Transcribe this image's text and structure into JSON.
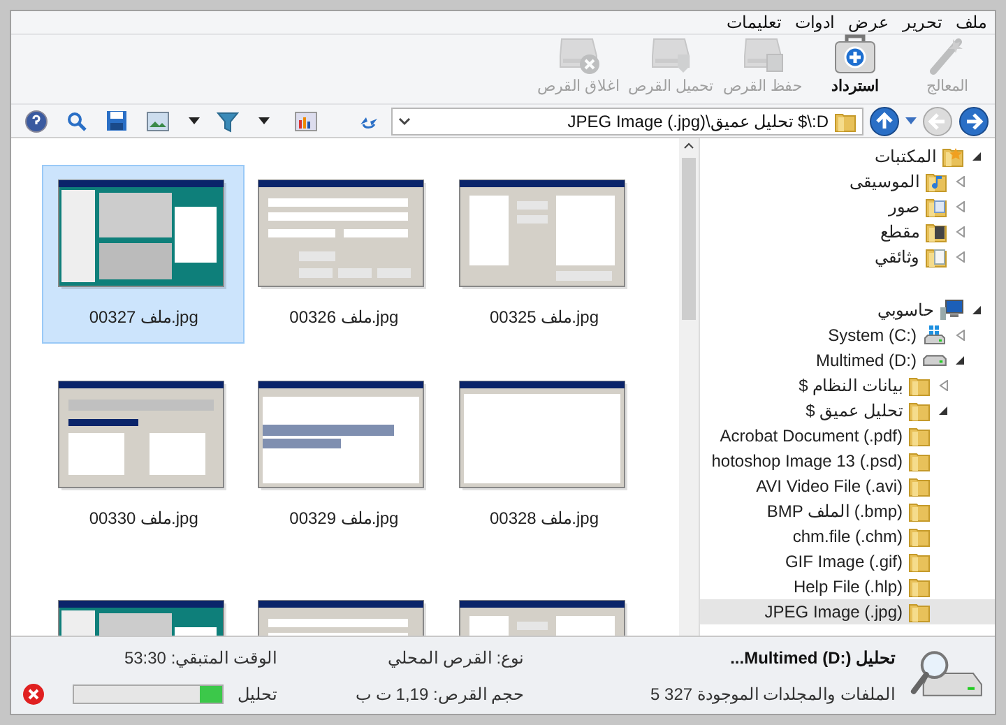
{
  "menu": [
    "ملف",
    "تحرير",
    "عرض",
    "ادوات",
    "تعليمات"
  ],
  "toolbar": [
    {
      "label": "المعالج",
      "kind": "wand",
      "disabled": true
    },
    {
      "label": "استرداد",
      "kind": "recover",
      "disabled": false
    },
    {
      "label": "حفظ القرص",
      "kind": "save",
      "disabled": true
    },
    {
      "label": "تحميل القرص",
      "kind": "load",
      "disabled": true
    },
    {
      "label": "اغلاق القرص",
      "kind": "close",
      "disabled": true
    }
  ],
  "address": {
    "value": "D:\\$ تحليل عميق\\JPEG Image (.jpg)"
  },
  "thumbnails": [
    {
      "label": "00325 ملف.jpg",
      "selected": false
    },
    {
      "label": "00326 ملف.jpg",
      "selected": false
    },
    {
      "label": "00327 ملف.jpg",
      "selected": true
    },
    {
      "label": "00328 ملف.jpg",
      "selected": false
    },
    {
      "label": "00329 ملف.jpg",
      "selected": false
    },
    {
      "label": "00330 ملف.jpg",
      "selected": false
    },
    {
      "kind": "picture"
    },
    {
      "kind": "picture"
    },
    {
      "kind": "picture"
    }
  ],
  "tree": [
    {
      "label": "المكتبات",
      "kind": "library",
      "expanded": true,
      "children": [
        {
          "label": "الموسيقى",
          "kind": "music",
          "expanded": false
        },
        {
          "label": "صور",
          "kind": "pictures",
          "expanded": false
        },
        {
          "label": "مقطع",
          "kind": "video",
          "expanded": false
        },
        {
          "label": "وثائقي",
          "kind": "documents",
          "expanded": false
        }
      ]
    },
    {
      "label": "حاسوبي",
      "kind": "computer",
      "expanded": true,
      "children": [
        {
          "label": "System (C:)",
          "kind": "sysdrive",
          "expanded": false
        },
        {
          "label": "Multimed (D:)",
          "kind": "drive",
          "expanded": true,
          "children": [
            {
              "label": "بيانات النظام $",
              "kind": "folder",
              "expanded": false
            },
            {
              "label": "تحليل عميق $",
              "kind": "folder",
              "expanded": true,
              "children": [
                {
                  "label": "Acrobat Document (.pdf)",
                  "kind": "folder",
                  "selected": false
                },
                {
                  "label": "hotoshop Image 13 (.psd)",
                  "kind": "folder",
                  "selected": false
                },
                {
                  "label": "AVI Video File (.avi)",
                  "kind": "folder",
                  "selected": false
                },
                {
                  "label": "BMP الملف (.bmp)",
                  "kind": "folder",
                  "selected": false
                },
                {
                  "label": "chm.file (.chm)",
                  "kind": "folder",
                  "selected": false
                },
                {
                  "label": "GIF Image (.gif)",
                  "kind": "folder",
                  "selected": false
                },
                {
                  "label": "Help File (.hlp)",
                  "kind": "folder",
                  "selected": false
                },
                {
                  "label": "JPEG Image (.jpg)",
                  "kind": "folder",
                  "selected": true
                }
              ]
            }
          ]
        }
      ]
    }
  ],
  "status": {
    "title": "تحليل Multimed (D:)...",
    "found": "الملفات والمجلدات الموجودة 5 327",
    "type": "نوع: القرص المحلي",
    "size": "حجم القرص: 1,19 ت ب",
    "remaining": "الوقت المتبقي: 53:30",
    "progress_label": "تحليل",
    "level": 0.15
  }
}
